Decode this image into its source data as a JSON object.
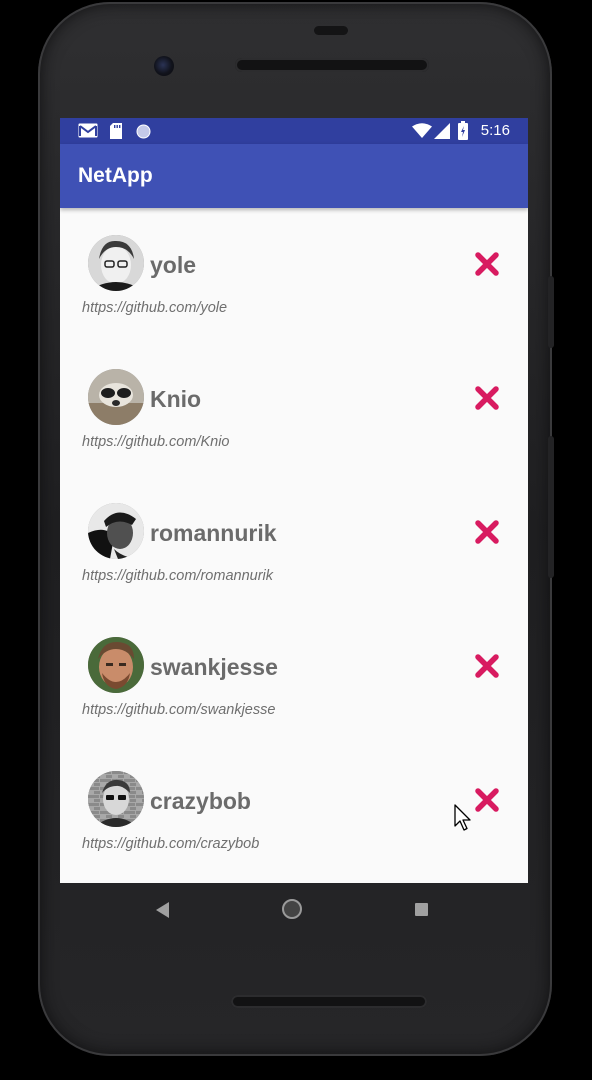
{
  "status_bar": {
    "time": "5:16",
    "icons": [
      "gmail-icon",
      "sd-card-icon",
      "circle-icon",
      "wifi-icon",
      "signal-icon",
      "battery-icon"
    ]
  },
  "app_bar": {
    "title": "NetApp",
    "color": "#3f51b5",
    "status_color": "#303f9f"
  },
  "users": [
    {
      "name": "yole",
      "url": "https://github.com/yole",
      "avatar": "yole-avatar"
    },
    {
      "name": "Knio",
      "url": "https://github.com/Knio",
      "avatar": "knio-avatar"
    },
    {
      "name": "romannurik",
      "url": "https://github.com/romannurik",
      "avatar": "romannurik-avatar"
    },
    {
      "name": "swankjesse",
      "url": "https://github.com/swankjesse",
      "avatar": "swankjesse-avatar"
    },
    {
      "name": "crazybob",
      "url": "https://github.com/crazybob",
      "avatar": "crazybob-avatar"
    }
  ],
  "colors": {
    "delete": "#d81b60",
    "background": "#fafafa"
  },
  "nav_bar": {
    "icons": [
      "back-icon",
      "home-icon",
      "recents-icon"
    ]
  }
}
